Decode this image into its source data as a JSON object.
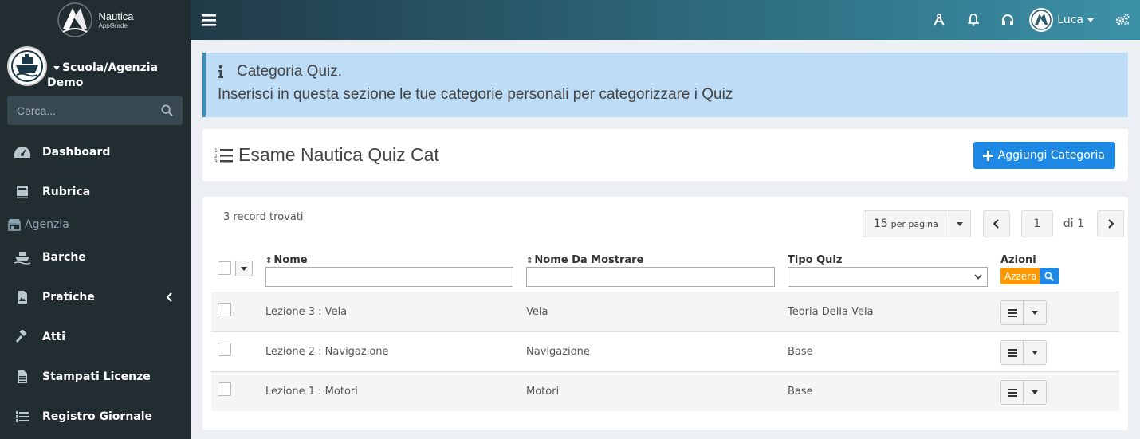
{
  "brand": {
    "title": "Nautica",
    "subtitle": "AppGrade"
  },
  "user_panel": {
    "agency": "Scuola/Agenzia Demo"
  },
  "sidebar_search": {
    "placeholder": "Cerca..."
  },
  "sidebar": {
    "items": [
      {
        "label": "Dashboard",
        "icon": "dashboard-icon"
      },
      {
        "label": "Rubrica",
        "icon": "book-icon"
      },
      {
        "label": "Agenzia",
        "icon": "store-icon",
        "header": true
      },
      {
        "label": "Barche",
        "icon": "ship-icon"
      },
      {
        "label": "Pratiche",
        "icon": "file-image-icon",
        "has_children": true
      },
      {
        "label": "Atti",
        "icon": "gavel-icon"
      },
      {
        "label": "Stampati Licenze",
        "icon": "file-text-icon"
      },
      {
        "label": "Registro Giornale",
        "icon": "list-ol-icon"
      }
    ]
  },
  "navbar": {
    "user_name": "Luca"
  },
  "callout": {
    "title": "Categoria Quiz.",
    "text": "Inserisci in questa sezione le tue categorie personali per categorizzare i Quiz"
  },
  "page": {
    "title": "Esame Nautica Quiz Cat",
    "add_button": "Aggiungi Categoria"
  },
  "table": {
    "records_found": "3 record trovati",
    "per_page_value": "15",
    "per_page_label": "per pagina",
    "current_page": "1",
    "of_pages": "di 1",
    "columns": {
      "nome": "Nome",
      "nome_da_mostrare": "Nome Da Mostrare",
      "tipo_quiz": "Tipo Quiz",
      "azioni": "Azioni"
    },
    "reset_button": "Azzera",
    "rows": [
      {
        "nome": "Lezione 3 : Vela",
        "nome_da_mostrare": "Vela",
        "tipo_quiz": "Teoria Della Vela"
      },
      {
        "nome": "Lezione 2 : Navigazione",
        "nome_da_mostrare": "Navigazione",
        "tipo_quiz": "Base"
      },
      {
        "nome": "Lezione 1 : Motori",
        "nome_da_mostrare": "Motori",
        "tipo_quiz": "Base"
      }
    ]
  },
  "colors": {
    "sidebar_bg": "#222d32",
    "accent_blue": "#1e88e5",
    "reset_orange": "#ff9800",
    "callout_bg": "#bddcf5"
  }
}
